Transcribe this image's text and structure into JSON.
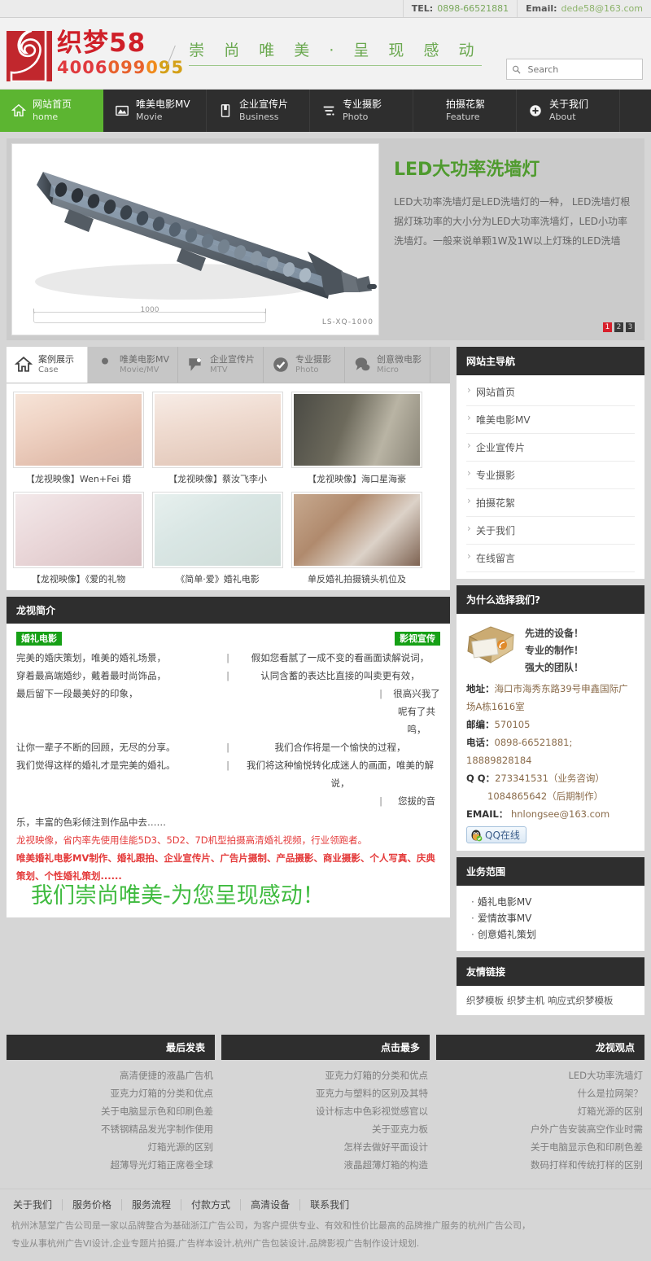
{
  "topbar": {
    "tel_label": "TEL:",
    "tel_value": "0898-66521881",
    "email_label": "Email:",
    "email_value": "dede58@163.com"
  },
  "header": {
    "logo_title": "织梦58",
    "logo_phone": "4006099095",
    "slogan": "崇 尚 唯 美 · 呈 现 感 动",
    "search_placeholder": "Search"
  },
  "nav": {
    "items": [
      {
        "cn": "网站首页",
        "en": "home",
        "icon": "home-icon",
        "active": true
      },
      {
        "cn": "唯美电影MV",
        "en": "Movie",
        "icon": "film-icon",
        "active": false
      },
      {
        "cn": "企业宣传片",
        "en": "Business",
        "icon": "book-icon",
        "active": false
      },
      {
        "cn": "专业摄影",
        "en": "Photo",
        "icon": "list-icon",
        "active": false
      },
      {
        "cn": "拍摄花絮",
        "en": "Feature",
        "icon": "heart-icon",
        "active": false
      },
      {
        "cn": "关于我们",
        "en": "About",
        "icon": "plus-icon",
        "active": false
      }
    ]
  },
  "banner": {
    "title": "LED大功率洗墙灯",
    "desc": "LED大功率洗墙灯是LED洗墙灯的一种， LED洗墙灯根据灯珠功率的大小分为LED大功率洗墙灯，LED小功率洗墙灯。一般来说单颗1W及1W以上灯珠的LED洗墙",
    "image_caption": "1000",
    "image_model": "LS-XQ-1000",
    "dots": [
      "1",
      "2",
      "3"
    ],
    "active_dot": 0
  },
  "case": {
    "tabs": [
      {
        "cn": "案例展示",
        "en": "Case",
        "icon": "home-icon",
        "active": true
      },
      {
        "cn": "唯美电影MV",
        "en": "Movie/MV",
        "icon": "user-icon",
        "active": false
      },
      {
        "cn": "企业宣传片",
        "en": "MTV",
        "icon": "pin-icon",
        "active": false
      },
      {
        "cn": "专业摄影",
        "en": "Photo",
        "icon": "check-icon",
        "active": false
      },
      {
        "cn": "创意微电影",
        "en": "Micro",
        "icon": "chat-icon",
        "active": false
      }
    ],
    "items": [
      {
        "caption": "【龙视映像】Wen+Fei 婚"
      },
      {
        "caption": "【龙视映像】蔡汝飞李小"
      },
      {
        "caption": "【龙视映像】海口星海豪"
      },
      {
        "caption": "【龙视映像】《爱的礼物"
      },
      {
        "caption": "《简单·爱》婚礼电影"
      },
      {
        "caption": "单反婚礼拍摄镜头机位及"
      }
    ]
  },
  "intro": {
    "title": "龙视简介",
    "tag_left": "婚礼电影",
    "tag_right": "影视宣传",
    "rows": [
      {
        "l": "完美的婚庆策划，唯美的婚礼场景，",
        "r": "假如您看腻了一成不变的看画面读解说词，",
        "indent": false
      },
      {
        "l": "穿着最高端婚纱，戴着最时尚饰品，",
        "r": "认同含蓄的表达比直接的叫卖更有效，",
        "indent": false
      },
      {
        "l": "最后留下一段最美好的印象，",
        "r": "很高兴我了呢有了共鸣，",
        "indent": true
      },
      {
        "l": "让你一辈子不断的回顾，无尽的分享。",
        "r": "我们合作将是一个愉快的过程，",
        "indent": false
      },
      {
        "l": "我们觉得这样的婚礼才是完美的婚礼。",
        "r": "我们将这种愉悦转化成迷人的画面，唯美的解说，",
        "indent": false
      },
      {
        "l": "",
        "r": "您拔的音",
        "indent": true
      }
    ],
    "tail": "乐，丰富的色彩倾注到作品中去……",
    "red_line": "龙视映像，省内率先使用佳能5D3、5D2、7D机型拍摄高清婚礼视频，行业领跑者。",
    "red_bold": "唯美婚礼电影MV制作、婚礼跟拍、企业宣传片、广告片摄制、产品摄影、商业摄影、个人写真、庆典策划、个性婚礼策划......",
    "big_green": "我们崇尚唯美-为您呈现感动！"
  },
  "sidebar": {
    "nav_title": "网站主导航",
    "nav_items": [
      "网站首页",
      "唯美电影MV",
      "企业宣传片",
      "专业摄影",
      "拍摄花絮",
      "关于我们",
      "在线留言"
    ],
    "why_title": "为什么选择我们?",
    "why_lines": [
      "先进的设备！",
      "专业的制作！",
      "强大的团队！"
    ],
    "address_label": "地址：",
    "address_value": "海口市海秀东路39号申鑫国际广场A栋1616室",
    "zip_label": "邮编：",
    "zip_value": "570105",
    "phone_label": "电话：",
    "phone_value": "0898-66521881; 18889828184",
    "qq_label": "Q Q：",
    "qq_value": "273341531（业务咨询）",
    "qq_value2": "1084865642（后期制作）",
    "email_label": "EMAIL：",
    "email_value": "hnlongsee@163.com",
    "qq_button": "QQ在线",
    "biz_title": "业务范围",
    "biz_items": [
      "婚礼电影MV",
      "爱情故事MV",
      "创意婚礼策划"
    ],
    "links_title": "友情链接",
    "links_items": [
      "织梦模板",
      "织梦主机",
      "响应式织梦模板"
    ]
  },
  "bottom": {
    "columns": [
      {
        "title": "最后发表",
        "items": [
          "高清便捷的液晶广告机",
          "亚克力灯箱的分类和优点",
          "关于电脑显示色和印刷色差",
          "不锈钢精品发光字制作使用",
          "灯箱光源的区别",
          "超薄导光灯箱正席卷全球"
        ]
      },
      {
        "title": "点击最多",
        "items": [
          "亚克力灯箱的分类和优点",
          "亚克力与塑料的区别及其特",
          "设计标志中色彩视觉感官以",
          "关于亚克力板",
          "怎样去做好平面设计",
          "液晶超薄灯箱的构造"
        ]
      },
      {
        "title": "龙视观点",
        "items": [
          "LED大功率洗墙灯",
          "什么是拉网架？",
          "灯箱光源的区别",
          "户外广告安装高空作业时需",
          "关于电脑显示色和印刷色差",
          "数码打样和传统打样的区别"
        ]
      }
    ]
  },
  "footer": {
    "links": [
      "关于我们",
      "服务价格",
      "服务流程",
      "付款方式",
      "高清设备",
      "联系我们"
    ],
    "line1": "杭州沐慧堂广告公司是一家以品牌整合为基础浙江广告公司，为客户提供专业、有效和性价比最高的品牌推广服务的杭州广告公司，",
    "line2": "专业从事杭州广告VI设计,企业专题片拍摄,广告样本设计,杭州广告包装设计,品牌影视广告制作设计规划."
  },
  "colors": {
    "accent_green": "#5cb531",
    "brand_red": "#cf1f28",
    "dark_header": "#2e2e2e",
    "page_bg": "#d6d6d6"
  }
}
